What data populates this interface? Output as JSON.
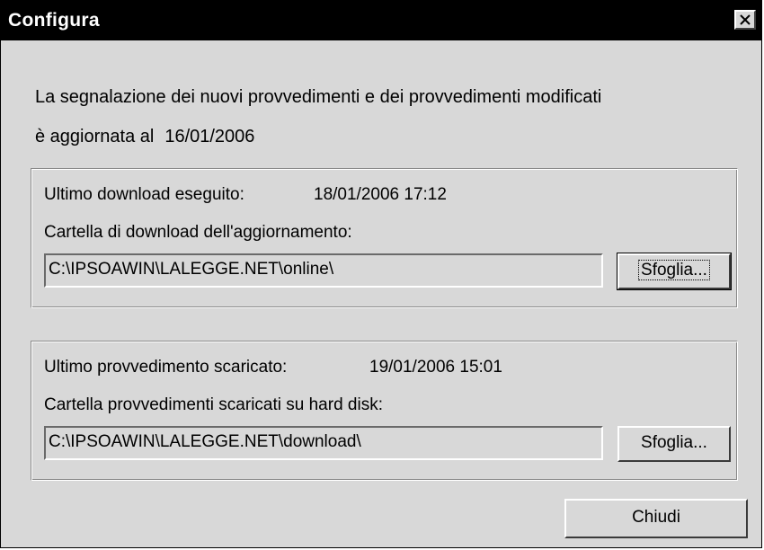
{
  "window": {
    "title": "Configura",
    "close_glyph": "✕"
  },
  "intro": {
    "line1": "La segnalazione dei nuovi provvedimenti e dei provvedimenti modificati",
    "line2_prefix": "è aggiornata al",
    "line2_date": "16/01/2006"
  },
  "download_group": {
    "last_label": "Ultimo download eseguito:",
    "last_value": "18/01/2006 17:12",
    "folder_label": "Cartella di download dell'aggiornamento:",
    "folder_path": "C:\\IPSOAWIN\\LALEGGE.NET\\online\\",
    "browse_label": "Sfoglia..."
  },
  "provvedimenti_group": {
    "last_label": "Ultimo provvedimento scaricato:",
    "last_value": "19/01/2006 15:01",
    "folder_label": "Cartella provvedimenti scaricati su hard disk:",
    "folder_path": "C:\\IPSOAWIN\\LALEGGE.NET\\download\\",
    "browse_label": "Sfoglia..."
  },
  "footer": {
    "close_label": "Chiudi"
  }
}
